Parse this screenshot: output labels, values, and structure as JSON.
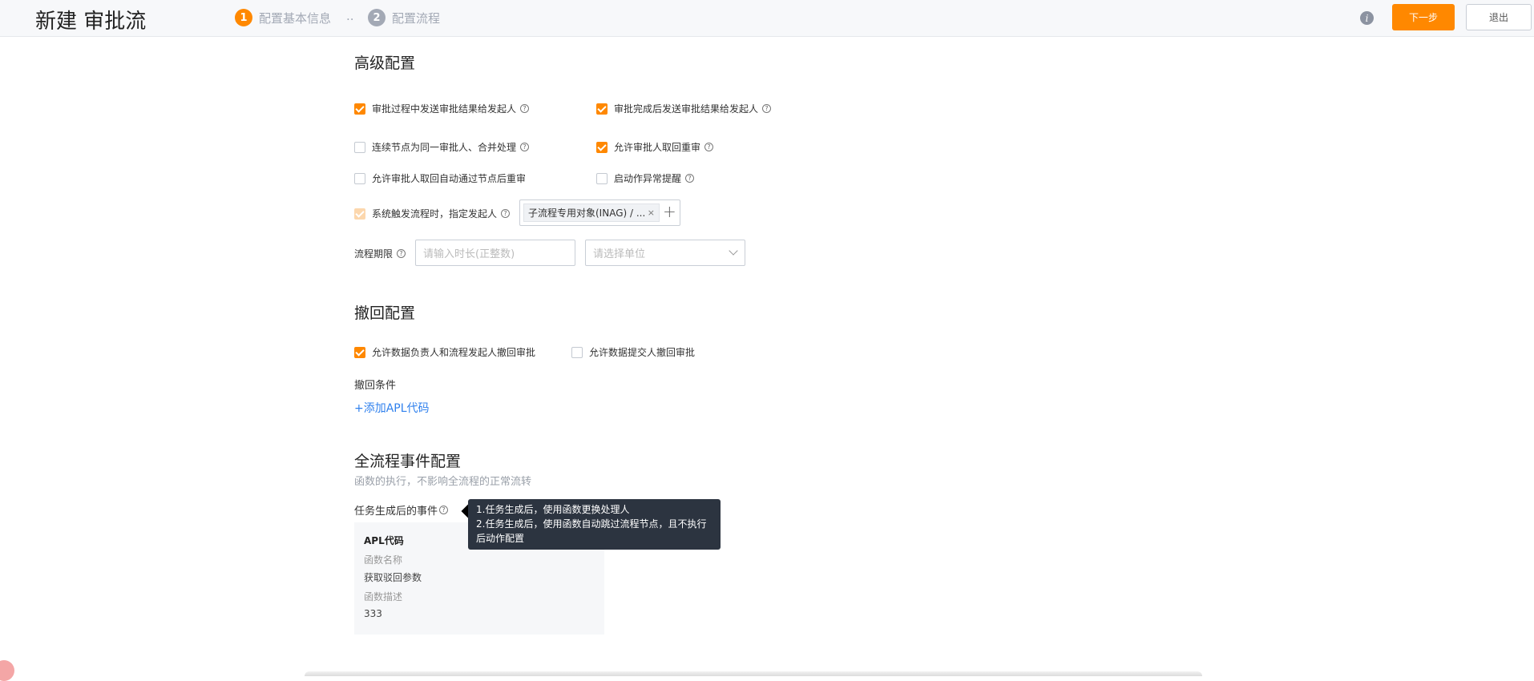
{
  "header": {
    "title": "新建 审批流",
    "steps": [
      {
        "num": "1",
        "label": "配置基本信息"
      },
      {
        "num": "2",
        "label": "配置流程"
      }
    ],
    "step_separator": "..",
    "info_icon": "i",
    "next_label": "下一步",
    "exit_label": "退出"
  },
  "advanced": {
    "title": "高级配置",
    "options": [
      {
        "label": "审批过程中发送审批结果给发起人",
        "checked": true
      },
      {
        "label": "审批完成后发送审批结果给发起人",
        "checked": true
      },
      {
        "label": "连续节点为同一审批人、合并处理",
        "checked": false
      },
      {
        "label": "允许审批人取回重审",
        "checked": true
      },
      {
        "label": "允许审批人取回自动通过节点后重审",
        "checked": false
      },
      {
        "label": "启动作异常提醒",
        "checked": false
      },
      {
        "label": "系统触发流程时，指定发起人",
        "checked": true,
        "disabled": true
      }
    ],
    "initiator_tag": "子流程专用对象(INAG) / ...",
    "tag_close": "×",
    "tag_add": "+",
    "deadline_label": "流程期限",
    "duration_placeholder": "请输入时长(正整数)",
    "unit_placeholder": "请选择单位"
  },
  "withdraw": {
    "title": "撤回配置",
    "options": [
      {
        "label": "允许数据负责人和流程发起人撤回审批",
        "checked": true
      },
      {
        "label": "允许数据提交人撤回审批",
        "checked": false
      }
    ],
    "condition_label": "撤回条件",
    "add_apl_link": "+添加APL代码"
  },
  "events": {
    "title": "全流程事件配置",
    "subtitle": "函数的执行，不影响全流程的正常流转",
    "task_event_label": "任务生成后的事件",
    "apl": {
      "title": "APL代码",
      "name_key": "函数名称",
      "name_value": "获取驳回参数",
      "desc_key": "函数描述",
      "desc_value": "333"
    },
    "tooltip": {
      "line1": "1.任务生成后，使用函数更换处理人",
      "line2": "2.任务生成后，使用函数自动跳过流程节点，且不执行后动作配置"
    }
  },
  "colors": {
    "accent": "#ff8800",
    "link": "#2f80ed"
  },
  "help_icon": "?"
}
